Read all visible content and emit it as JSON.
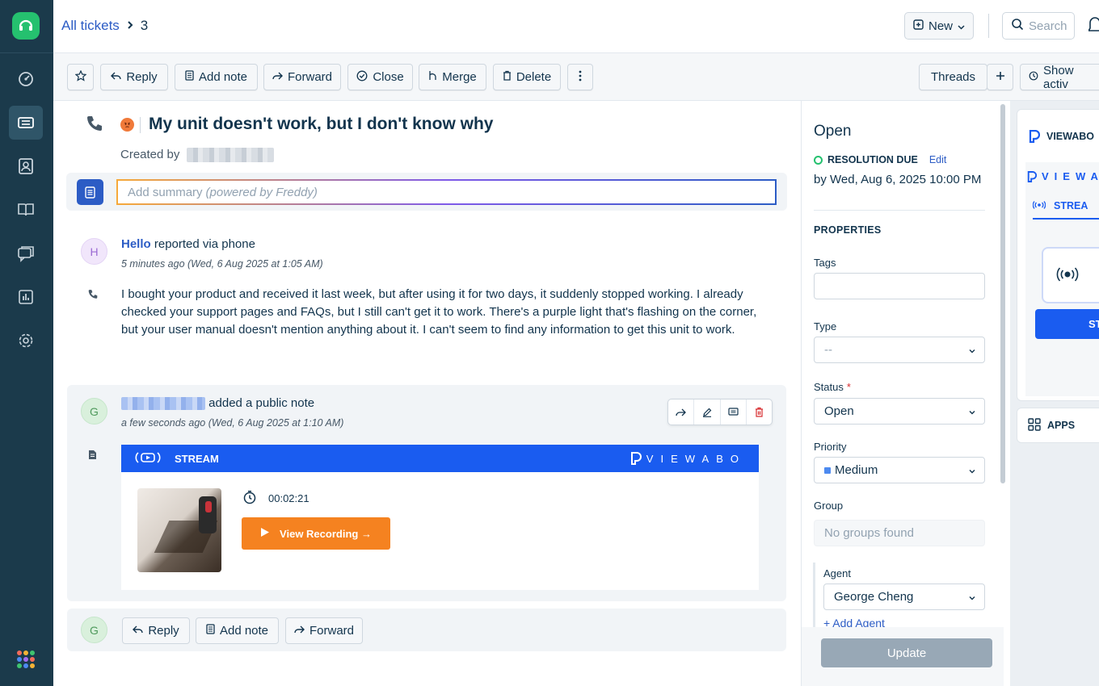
{
  "header": {
    "breadcrumb_link": "All tickets",
    "ticket_number": "3",
    "new_label": "New",
    "search_placeholder": "Search"
  },
  "toolbar": {
    "reply": "Reply",
    "add_note": "Add note",
    "forward": "Forward",
    "close": "Close",
    "merge": "Merge",
    "delete": "Delete",
    "threads": "Threads",
    "show_activities": "Show activ"
  },
  "ticket": {
    "subject": "My unit doesn't work, but I don't know why",
    "created_by_label": "Created by",
    "summary_placeholder": "Add summary",
    "summary_powered": "(powered by Freddy)"
  },
  "message": {
    "avatar_initial": "H",
    "sender": "Hello",
    "channel_text": "reported via phone",
    "time": "5 minutes ago (Wed, 6 Aug 2025 at 1:05 AM)",
    "body": "I bought your product and received it last week, but after using it for two days, it suddenly stopped working. I already checked your support pages and FAQs, but I still can't get it to work. There's a purple light that's flashing on the corner, but your user manual doesn't mention anything about it. I can't seem to find any information to get this unit to work."
  },
  "note": {
    "avatar_initial": "G",
    "action_text": "added a public note",
    "time": "a few seconds ago (Wed, 6 Aug 2025 at 1:10 AM)",
    "embed": {
      "bar_label": "STREAM",
      "brand": "VIEWABO",
      "duration": "00:02:21",
      "button_label": "View Recording →"
    }
  },
  "reply_bar": {
    "avatar_initial": "G",
    "reply": "Reply",
    "add_note": "Add note",
    "forward": "Forward"
  },
  "properties": {
    "status_title": "Open",
    "resolution_label": "RESOLUTION DUE",
    "edit_label": "Edit",
    "due_text": "by Wed, Aug 6, 2025 10:00 PM",
    "section_title": "PROPERTIES",
    "tags_label": "Tags",
    "type_label": "Type",
    "type_value": "--",
    "status_label": "Status",
    "status_value": "Open",
    "priority_label": "Priority",
    "priority_value": "Medium",
    "priority_color": "#4d8af0",
    "group_label": "Group",
    "group_value": "No groups found",
    "agent_label": "Agent",
    "agent_value": "George Cheng",
    "add_agent": "+ Add Agent",
    "update_label": "Update"
  },
  "apps_panel": {
    "app_title": "VIEWABO",
    "app_inner_brand": "VIEWA",
    "app_tab": "STREA",
    "app_start": "STA",
    "apps_label": "APPS"
  },
  "colors": {
    "nav_bg": "#1b3a4b",
    "accent_blue": "#2c5cc5",
    "stream_blue": "#1a5cf0",
    "view_orange": "#f58220",
    "freshdesk_green": "#25c16f"
  }
}
